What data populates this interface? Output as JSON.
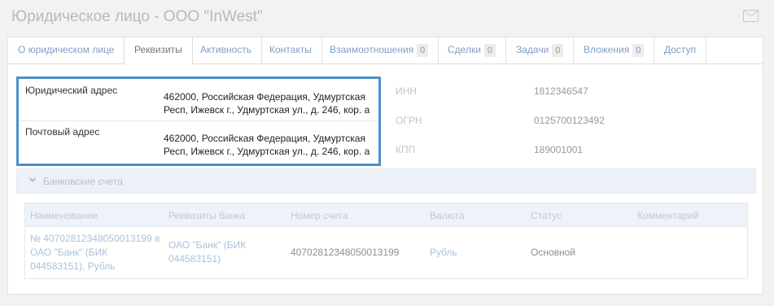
{
  "header": {
    "title": "Юридическое лицо - ООО \"InWest\""
  },
  "tabs": [
    {
      "label": "О юридическом лице",
      "badge": null,
      "active": false
    },
    {
      "label": "Реквизиты",
      "badge": null,
      "active": true
    },
    {
      "label": "Активность",
      "badge": null,
      "active": false
    },
    {
      "label": "Контакты",
      "badge": null,
      "active": false
    },
    {
      "label": "Взаимоотношения",
      "badge": "0",
      "active": false
    },
    {
      "label": "Сделки",
      "badge": "0",
      "active": false
    },
    {
      "label": "Задачи",
      "badge": "0",
      "active": false
    },
    {
      "label": "Вложения",
      "badge": "0",
      "active": false
    },
    {
      "label": "Доступ",
      "badge": null,
      "active": false
    }
  ],
  "addresses": {
    "legal": {
      "label": "Юридический адрес",
      "value": "462000, Российская Федерация, Удмуртская Респ, Ижевск г., Удмуртская ул., д. 246, кор. а"
    },
    "postal": {
      "label": "Почтовый адрес",
      "value": "462000, Российская Федерация, Удмуртская Респ, Ижевск г., Удмуртская ул., д. 246, кор. а"
    }
  },
  "requisites": {
    "inn": {
      "label": "ИНН",
      "value": "1812346547"
    },
    "ogrn": {
      "label": "ОГРН",
      "value": "0125700123492"
    },
    "kpp": {
      "label": "КПП",
      "value": "189001001"
    }
  },
  "bank_accounts": {
    "title": "Банковские счета",
    "columns": [
      "Наименование",
      "Реквизиты банка",
      "Номер счета",
      "Валюта",
      "Статус",
      "Комментарий"
    ],
    "rows": [
      {
        "name_lines": [
          "№ 40702812348050013199 в",
          "ОАО \"Банк\" (БИК",
          "044583151), Рубль"
        ],
        "bank_lines": [
          "ОАО \"Банк\" (БИК",
          "044583151)"
        ],
        "account_number": "40702812348050013199",
        "currency": "Рубль",
        "status": "Основной",
        "comment": ""
      }
    ]
  },
  "colors": {
    "accent_border": "#4f90c5",
    "link": "#7f9fc3"
  },
  "icons": {
    "mail": "envelope-icon",
    "collapse": "chevron-down-icon"
  }
}
